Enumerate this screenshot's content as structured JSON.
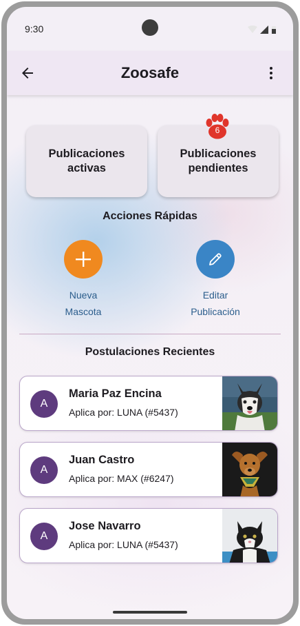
{
  "status_bar": {
    "time": "9:30"
  },
  "app_bar": {
    "title": "Zoosafe",
    "back_icon": "arrow-left-icon",
    "menu_icon": "more-vert-icon"
  },
  "cards": {
    "active_label": "Publicaciones activas",
    "pending_label": "Publicaciones pendientes",
    "pending_badge": "6",
    "badge_color": "#e0352b"
  },
  "quick_actions": {
    "title": "Acciones Rápidas",
    "new_pet_line1": "Nueva",
    "new_pet_line2": "Mascota",
    "edit_line1": "Editar",
    "edit_line2": "Publicación",
    "new_color": "#f0891f",
    "edit_color": "#3a85c6"
  },
  "recent": {
    "title": "Postulaciones Recientes",
    "items": [
      {
        "initial": "A",
        "name": "Maria Paz Encina",
        "subtitle": "Aplica por: LUNA (#5437)",
        "photo": "husky-dog-photo"
      },
      {
        "initial": "A",
        "name": "Juan Castro",
        "subtitle": "Aplica por: MAX (#6247)",
        "photo": "puppy-bandana-photo"
      },
      {
        "initial": "A",
        "name": "Jose Navarro",
        "subtitle": "Aplica por: LUNA (#5437)",
        "photo": "tuxedo-cat-photo"
      }
    ]
  }
}
